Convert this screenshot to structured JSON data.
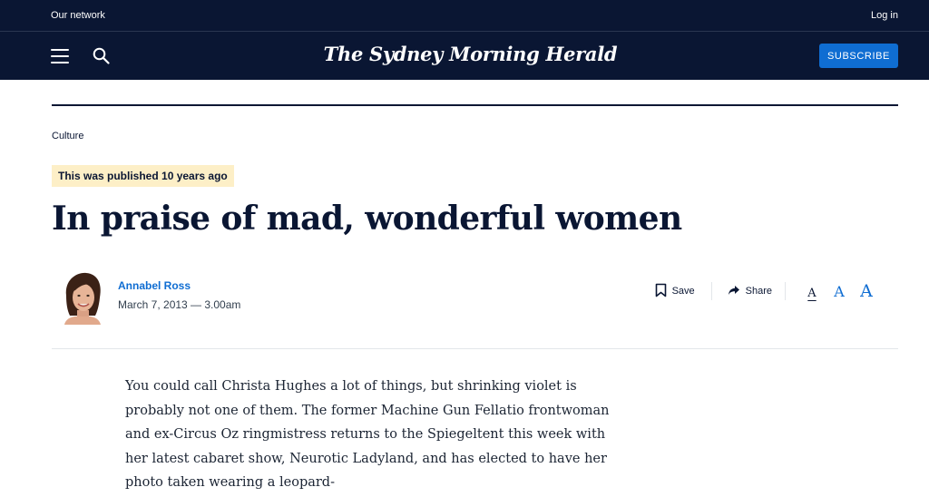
{
  "network_bar": {
    "our_network": "Our network",
    "log_in": "Log in"
  },
  "header": {
    "masthead": "The Sydney Morning Herald",
    "subscribe_label": "SUBSCRIBE"
  },
  "article": {
    "category": "Culture",
    "published_notice": "This was published 10 years ago",
    "headline": "In praise of mad, wonderful women",
    "author": "Annabel Ross",
    "date": "March 7, 2013 — 3.00am",
    "actions": {
      "save": "Save",
      "share": "Share"
    },
    "text_size": {
      "small": "A",
      "medium": "A",
      "large": "A"
    },
    "body": "You could call Christa Hughes a lot of things, but shrinking violet is probably not one of them. The former Machine Gun Fellatio frontwoman and ex-Circus Oz ringmistress returns to the Spiegeltent this week with her latest cabaret show, Neurotic Ladyland, and has elected to have her photo taken wearing a leopard-"
  },
  "colors": {
    "navy": "#0a1633",
    "accent_blue": "#0f6dd2",
    "badge_bg": "#fdefc7"
  },
  "icons": [
    "hamburger-menu-icon",
    "search-icon",
    "bookmark-icon",
    "share-arrow-icon"
  ]
}
